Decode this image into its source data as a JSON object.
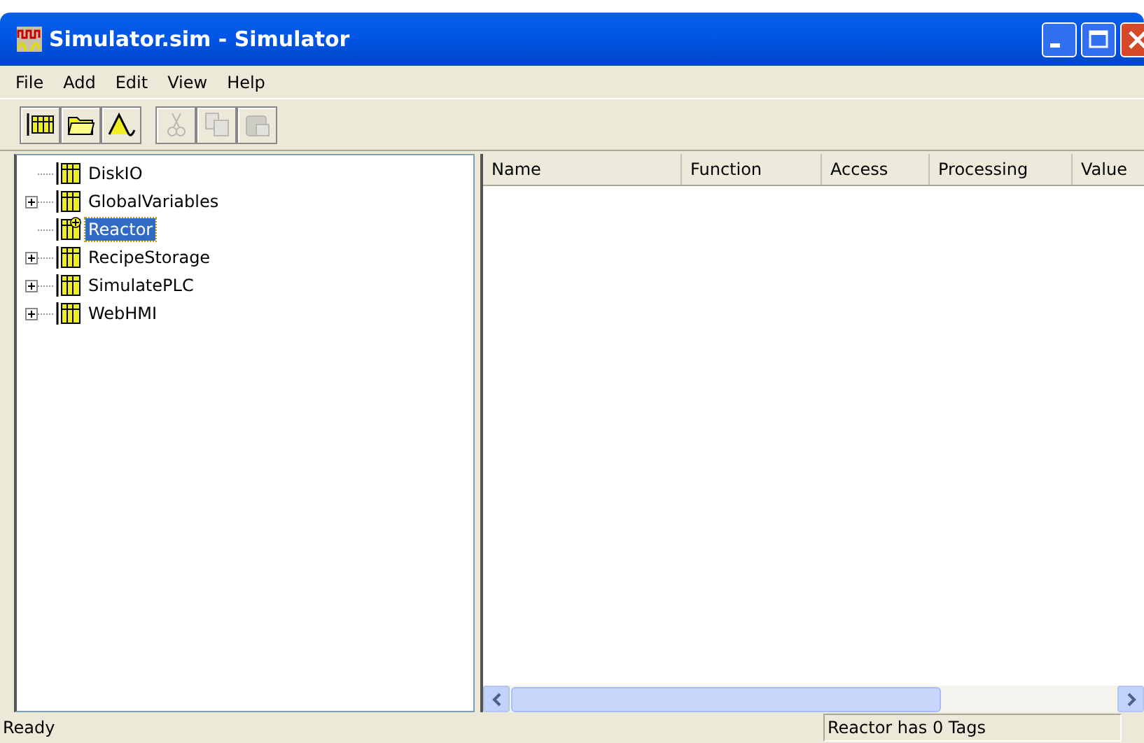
{
  "window": {
    "title": "Simulator.sim - Simulator"
  },
  "menu": [
    "File",
    "Add",
    "Edit",
    "View",
    "Help"
  ],
  "toolbar": [
    {
      "kind": "table",
      "disabled": false
    },
    {
      "kind": "folder",
      "disabled": false
    },
    {
      "kind": "wave",
      "disabled": false
    },
    {
      "kind": "cut",
      "disabled": true
    },
    {
      "kind": "copy",
      "disabled": true
    },
    {
      "kind": "paste",
      "disabled": true
    }
  ],
  "tree": [
    {
      "label": "DiskIO",
      "expandable": false,
      "selected": false,
      "kind": "table"
    },
    {
      "label": "GlobalVariables",
      "expandable": true,
      "selected": false,
      "kind": "table"
    },
    {
      "label": "Reactor",
      "expandable": false,
      "selected": true,
      "kind": "table-new"
    },
    {
      "label": "RecipeStorage",
      "expandable": true,
      "selected": false,
      "kind": "table"
    },
    {
      "label": "SimulatePLC",
      "expandable": true,
      "selected": false,
      "kind": "table"
    },
    {
      "label": "WebHMI",
      "expandable": true,
      "selected": false,
      "kind": "table"
    }
  ],
  "table": {
    "columns": [
      "Name",
      "Function",
      "Access",
      "Processing",
      "Value"
    ]
  },
  "status_bar": {
    "message": "Ready",
    "info": "Reactor has 0 Tags"
  }
}
